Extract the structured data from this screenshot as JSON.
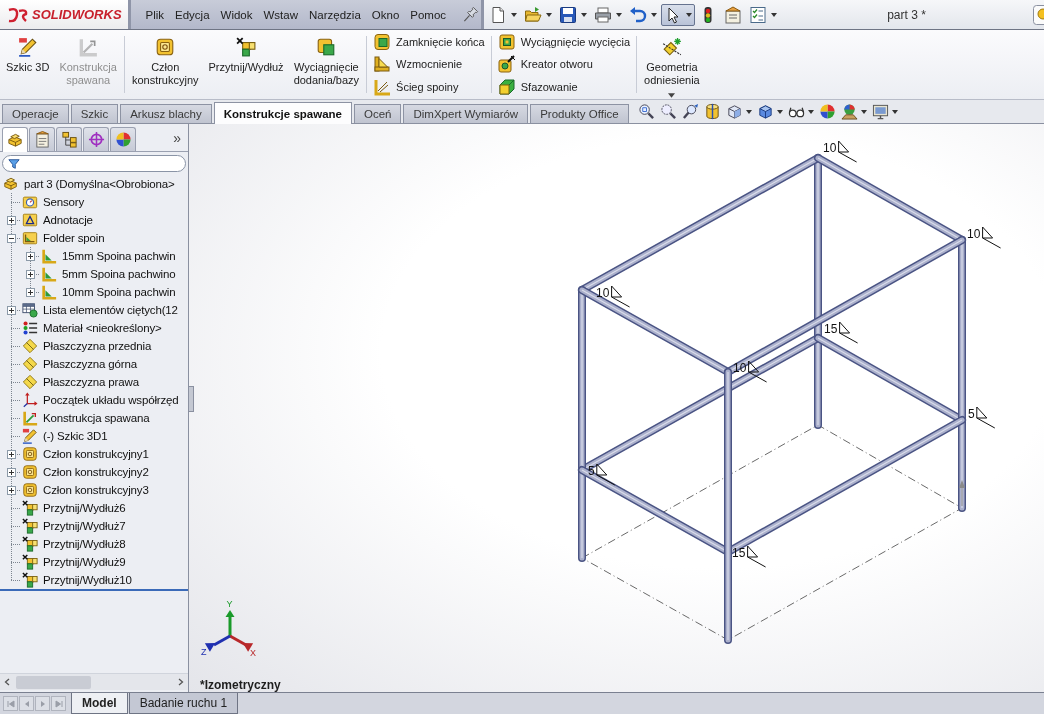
{
  "app": {
    "logo": "SOLIDWORKS"
  },
  "menu": [
    "Plik",
    "Edycja",
    "Widok",
    "Wstaw",
    "Narzędzia",
    "Okno",
    "Pomoc"
  ],
  "quick_toolbar": [
    {
      "selected": false,
      "dropdown": true
    },
    {
      "selected": false,
      "dropdown": true
    },
    {
      "selected": false,
      "dropdown": true
    },
    {
      "selected": false,
      "dropdown": true
    },
    {
      "selected": false,
      "dropdown": true
    },
    {
      "selected": true,
      "dropdown": true
    },
    {
      "selected": false,
      "dropdown": false
    },
    {
      "selected": false,
      "dropdown": false
    },
    {
      "selected": false,
      "dropdown": true
    }
  ],
  "window": {
    "title": "part 3 *"
  },
  "ribbon": {
    "groups": [
      {
        "kind": "large",
        "buttons": [
          {
            "label": "Szkic 3D",
            "disabled": false
          },
          {
            "label": "Konstrukcja spawana",
            "disabled": true
          }
        ]
      },
      {
        "kind": "large",
        "buttons": [
          {
            "label": "Człon konstrukcyjny",
            "disabled": false
          },
          {
            "label": "Przytnij/Wydłuż",
            "disabled": false
          },
          {
            "label": "Wyciągnięcie dodania/bazy",
            "disabled": false
          }
        ]
      },
      {
        "kind": "stack",
        "buttons": [
          {
            "label": "Zamknięcie końca",
            "disabled": false
          },
          {
            "label": "Wzmocnienie",
            "disabled": false
          },
          {
            "label": "Ścieg spoiny",
            "disabled": false
          }
        ]
      },
      {
        "kind": "stack",
        "buttons": [
          {
            "label": "Wyciągnięcie wycięcia",
            "disabled": false
          },
          {
            "label": "Kreator otworu",
            "disabled": false
          },
          {
            "label": "Sfazowanie",
            "disabled": false
          }
        ]
      },
      {
        "kind": "large",
        "buttons": [
          {
            "label": "Geometria odniesienia",
            "disabled": false,
            "dropdown": true
          }
        ]
      }
    ]
  },
  "command_tabs": [
    {
      "label": "Operacje",
      "selected": false
    },
    {
      "label": "Szkic",
      "selected": false
    },
    {
      "label": "Arkusz blachy",
      "selected": false
    },
    {
      "label": "Konstrukcje spawane",
      "selected": true
    },
    {
      "label": "Oceń",
      "selected": false
    },
    {
      "label": "DimXpert Wymiarów",
      "selected": false
    },
    {
      "label": "Produkty Office",
      "selected": false
    }
  ],
  "view_toolbar": [
    {
      "dropdown": false
    },
    {
      "dropdown": false
    },
    {
      "dropdown": false
    },
    {
      "dropdown": false
    },
    {
      "dropdown": true
    },
    {
      "dropdown": true
    },
    {
      "dropdown": true
    },
    {
      "dropdown": false
    },
    {
      "dropdown": true
    },
    {
      "dropdown": true
    }
  ],
  "panel": {
    "tabs": [
      {
        "selected": true
      },
      {
        "selected": false
      },
      {
        "selected": false
      },
      {
        "selected": false
      },
      {
        "selected": false
      }
    ],
    "more": "»",
    "tree": {
      "label": "part 3 (Domyślna<Obrobiona>",
      "kind": "part",
      "children": [
        {
          "label": "Sensory",
          "kind": "sensors"
        },
        {
          "label": "Adnotacje",
          "kind": "annotations",
          "expanded": false
        },
        {
          "label": "Folder spoin",
          "kind": "weldfolder",
          "expanded": true,
          "children": [
            {
              "label": "15mm Spoina pachwin",
              "kind": "weld",
              "expanded": false
            },
            {
              "label": "5mm Spoina pachwino",
              "kind": "weld",
              "expanded": false
            },
            {
              "label": "10mm Spoina pachwin",
              "kind": "weld",
              "expanded": false
            }
          ]
        },
        {
          "label": "Lista elementów ciętych(12",
          "kind": "cutlist",
          "expanded": false
        },
        {
          "label": "Materiał <nieokreślony>",
          "kind": "material"
        },
        {
          "label": "Płaszczyzna przednia",
          "kind": "plane"
        },
        {
          "label": "Płaszczyzna górna",
          "kind": "plane"
        },
        {
          "label": "Płaszczyzna prawa",
          "kind": "plane"
        },
        {
          "label": "Początek układu współrzęd",
          "kind": "origin"
        },
        {
          "label": "Konstrukcja spawana",
          "kind": "weldment"
        },
        {
          "label": "(-) Szkic 3D1",
          "kind": "sketch"
        },
        {
          "label": "Człon konstrukcyjny1",
          "kind": "member",
          "expanded": false
        },
        {
          "label": "Człon konstrukcyjny2",
          "kind": "member",
          "expanded": false
        },
        {
          "label": "Człon konstrukcyjny3",
          "kind": "member",
          "expanded": false
        },
        {
          "label": "Przytnij/Wydłuż6",
          "kind": "trim"
        },
        {
          "label": "Przytnij/Wydłuż7",
          "kind": "trim"
        },
        {
          "label": "Przytnij/Wydłuż8",
          "kind": "trim"
        },
        {
          "label": "Przytnij/Wydłuż9",
          "kind": "trim"
        },
        {
          "label": "Przytnij/Wydłuż10",
          "kind": "trim"
        }
      ]
    }
  },
  "viewport": {
    "weld_symbols": [
      "10",
      "10",
      "10",
      "10",
      "15",
      "5",
      "5",
      "15"
    ],
    "triad": {
      "y": "Y",
      "z": "Z",
      "x": "X"
    },
    "view_name": "*Izometryczny"
  },
  "bottom_tabs": [
    {
      "label": "Model",
      "selected": true
    },
    {
      "label": "Badanie ruchu 1",
      "selected": false
    }
  ]
}
